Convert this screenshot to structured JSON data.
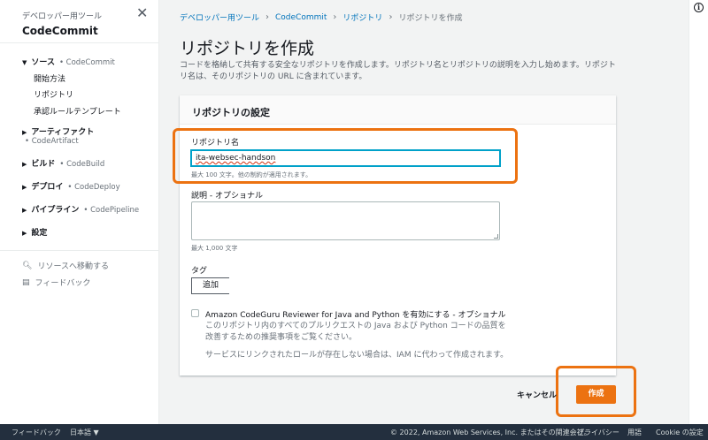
{
  "sidebar": {
    "subtitle": "デベロッパー用ツール",
    "title": "CodeCommit",
    "close_icon": "close-icon",
    "groups": [
      {
        "label": "ソース",
        "service": "• CodeCommit",
        "children": [
          "開始方法",
          "リポジトリ",
          "承認ルールテンプレート"
        ]
      },
      {
        "label": "アーティファクト",
        "service": "• CodeArtifact"
      },
      {
        "label": "ビルド",
        "service": "• CodeBuild"
      },
      {
        "label": "デプロイ",
        "service": "• CodeDeploy"
      },
      {
        "label": "パイプライン",
        "service": "• CodePipeline"
      },
      {
        "label": "設定",
        "service": ""
      }
    ],
    "go_to_resource": "リソースへ移動する",
    "feedback": "フィードバック"
  },
  "breadcrumb": {
    "items": [
      "デベロッパー用ツール",
      "CodeCommit",
      "リポジトリ"
    ],
    "current": "リポジトリを作成"
  },
  "page": {
    "title": "リポジトリを作成",
    "description": "コードを格納して共有する安全なリポジトリを作成します。リポジトリ名とリポジトリの説明を入力し始めます。リポジトリ名は、そのリポジトリの URL に含まれています。"
  },
  "form": {
    "panel_title": "リポジトリの設定",
    "name_label": "リポジトリ名",
    "name_value": "ita-websec-handson",
    "name_hint": "最大 100 文字。他の制約が適用されます。",
    "description_label": "説明 - オプショナル",
    "description_value": "",
    "description_hint": "最大 1,000 文字",
    "tags_label": "タグ",
    "add_button": "追加",
    "codeguru_label": "Amazon CodeGuru Reviewer for Java and Python を有効にする - オプショナル",
    "codeguru_desc": "このリポジトリ内のすべてのプルリクエストの Java および Python コードの品質を改善するための推奨事項をご覧ください。",
    "codeguru_note": "サービスにリンクされたロールが存在しない場合は、IAM に代わって作成されます。",
    "cancel_button": "キャンセル",
    "create_button": "作成"
  },
  "footer": {
    "feedback": "フィードバック",
    "language": "日本語 ▼",
    "copyright": "© 2022, Amazon Web Services, Inc. またはその関連会社。",
    "privacy": "プライバシー",
    "terms": "用語",
    "cookie": "Cookie の設定"
  },
  "colors": {
    "accent": "#ec7211",
    "link": "#0073bb",
    "footer_bg": "#232f3e"
  }
}
